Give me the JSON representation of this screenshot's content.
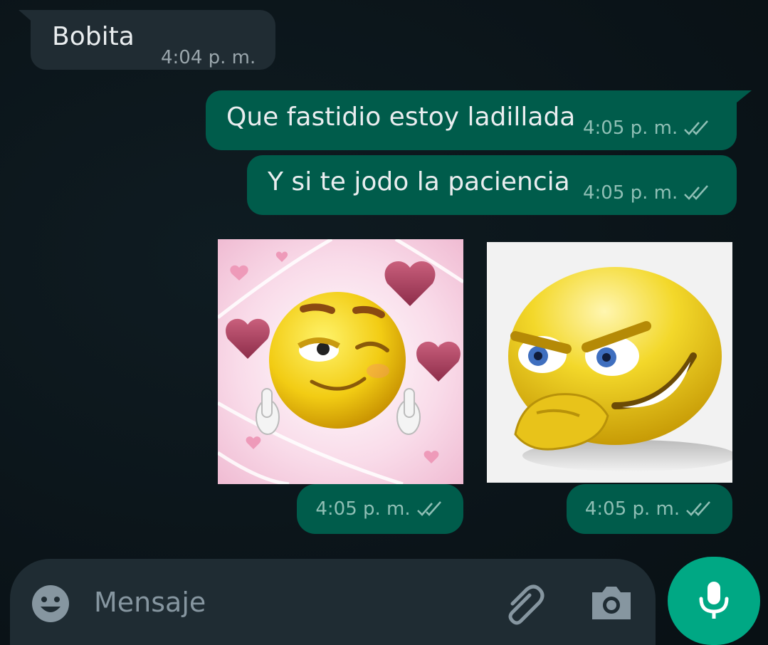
{
  "chat": {
    "messages": [
      {
        "direction": "incoming",
        "text": "Bobita",
        "time": "4:04 p. m."
      },
      {
        "direction": "outgoing",
        "text": "Que fastidio estoy ladillada",
        "time": "4:05 p. m.",
        "status": "delivered"
      },
      {
        "direction": "outgoing",
        "text": "Y si te jodo la paciencia",
        "time": "4:05 p. m.",
        "status": "delivered"
      }
    ],
    "stickers": [
      {
        "description_icon": "winking-smiley-with-hearts-sticker",
        "time": "4:05 p. m.",
        "status": "delivered"
      },
      {
        "description_icon": "scheming-smiley-sticker",
        "time": "4:05 p. m.",
        "status": "delivered"
      }
    ]
  },
  "composer": {
    "placeholder": "Mensaje",
    "emoji_icon": "emoji-icon",
    "attach_icon": "paperclip-icon",
    "camera_icon": "camera-icon",
    "mic_icon": "microphone-icon"
  },
  "colors": {
    "background": "#0b141a",
    "incoming_bubble": "#202c33",
    "outgoing_bubble": "#005c4b",
    "accent": "#00a884"
  }
}
